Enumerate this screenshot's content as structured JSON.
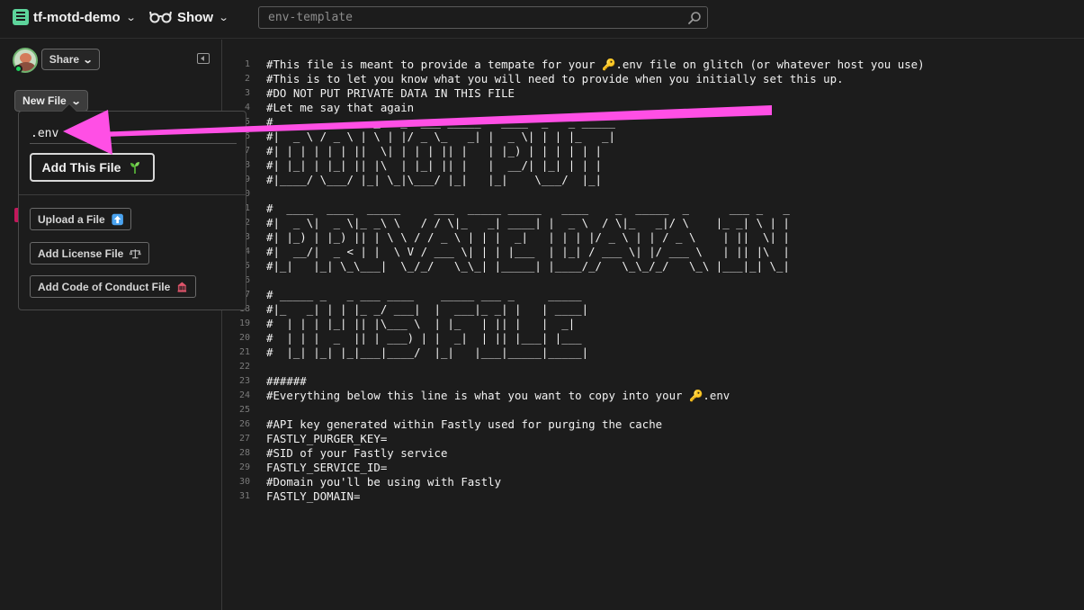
{
  "topbar": {
    "project_name": "tf-motd-demo",
    "show_label": "Show",
    "search": {
      "value": "",
      "placeholder": "env-template"
    }
  },
  "sidebar": {
    "share_label": "Share",
    "new_file_label": "New File"
  },
  "new_file_popover": {
    "filename_value": ".env",
    "add_this_file_label": "Add This File",
    "upload_label": "Upload a File",
    "license_label": "Add License File",
    "coc_label": "Add Code of Conduct File"
  },
  "editor": {
    "lines": [
      {
        "n": "1",
        "text": "#This file is meant to provide a tempate for your 🔑.env file on glitch (or whatever host you use)"
      },
      {
        "n": "2",
        "text": "#This is to let you know what you will need to provide when you initially set this up."
      },
      {
        "n": "3",
        "text": "#DO NOT PUT PRIVATE DATA IN THIS FILE"
      },
      {
        "n": "4",
        "text": "#Let me say that again"
      },
      {
        "n": "5",
        "text": "#  ____   ___   _   _  ___ _____   ____  _   _ _____"
      },
      {
        "n": "6",
        "text": "#|  _ \\ / _ \\ | \\ | |/ _ \\_   _| |  _ \\| | | |_   _|"
      },
      {
        "n": "7",
        "text": "#| | | | | | ||  \\| | | | || |   | |_) | | | | | |"
      },
      {
        "n": "8",
        "text": "#| |_| | |_| || |\\  | |_| || |   |  __/| |_| | | |"
      },
      {
        "n": "9",
        "text": "#|____/ \\___/ |_| \\_|\\___/ |_|   |_|    \\___/  |_|"
      },
      {
        "n": "10",
        "text": ""
      },
      {
        "n": "11",
        "text": "#  ____  ____  _____     ___  _____ _____   ____    _  _____  _      ___ _   _"
      },
      {
        "n": "12",
        "text": "#|  _ \\|  _ \\|_ _\\ \\   / / \\|_   _| ____| |  _ \\  / \\|_   _|/ \\    |_ _| \\ | |"
      },
      {
        "n": "13",
        "text": "#| |_) | |_) || | \\ \\ / / _ \\ | | |  _|   | | | |/ _ \\ | | / _ \\    | ||  \\| |"
      },
      {
        "n": "14",
        "text": "#|  __/|  _ < | |  \\ V / ___ \\| | | |___  | |_| / ___ \\| |/ ___ \\   | || |\\  |"
      },
      {
        "n": "15",
        "text": "#|_|   |_| \\_\\___|  \\_/_/   \\_\\_| |_____| |____/_/   \\_\\_/_/   \\_\\ |___|_| \\_|"
      },
      {
        "n": "16",
        "text": ""
      },
      {
        "n": "17",
        "text": "# _____ _   _ ___ ____    _____ ___ _     _____"
      },
      {
        "n": "18",
        "text": "#|_   _| | | |_ _/ ___|  |  ___|_ _| |   | ____|"
      },
      {
        "n": "19",
        "text": "#  | | | |_| || |\\___ \\  | |_   | || |   |  _|"
      },
      {
        "n": "20",
        "text": "#  | | |  _  || | ___) | |  _|  | || |___| |___"
      },
      {
        "n": "21",
        "text": "#  |_| |_| |_|___|____/  |_|   |___|_____|_____|"
      },
      {
        "n": "22",
        "text": ""
      },
      {
        "n": "23",
        "text": "######"
      },
      {
        "n": "24",
        "text": "#Everything below this line is what you want to copy into your 🔑.env"
      },
      {
        "n": "25",
        "text": ""
      },
      {
        "n": "26",
        "text": "#API key generated within Fastly used for purging the cache"
      },
      {
        "n": "27",
        "text": "FASTLY_PURGER_KEY="
      },
      {
        "n": "28",
        "text": "#SID of your Fastly service"
      },
      {
        "n": "29",
        "text": "FASTLY_SERVICE_ID="
      },
      {
        "n": "30",
        "text": "#Domain you'll be using with Fastly"
      },
      {
        "n": "31",
        "text": "FASTLY_DOMAIN="
      }
    ]
  },
  "icons": {
    "project": "project-icon",
    "show": "glasses-icon",
    "search": "search-icon",
    "collapse": "collapse-sidebar-icon",
    "add_this_file": "sprout-icon",
    "upload": "up-arrow-icon",
    "license": "scales-icon",
    "coc": "carousel-icon"
  },
  "colors": {
    "background": "#1c1c1c",
    "project_logo": "#5dd49b",
    "online_status": "#1bd15b",
    "annotation_arrow": "#ff4fe5",
    "upload_icon": "#4aa3f0"
  }
}
